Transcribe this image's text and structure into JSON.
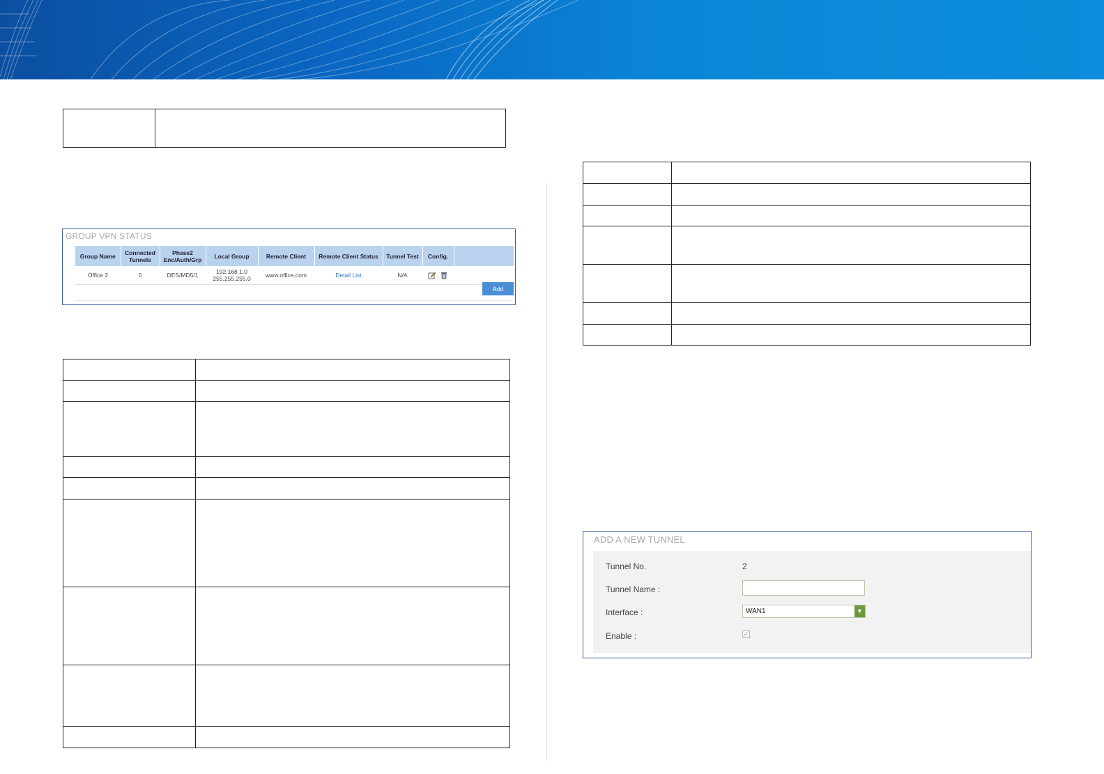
{
  "group_vpn_status": {
    "title": "GROUP VPN STATUS",
    "columns": [
      "Group Name",
      "Connected Tunnels",
      "Phase2 Enc/Auth/Grp",
      "Local Group",
      "Remote Client",
      "Remote Client Status",
      "Tunnel Test",
      "Config."
    ],
    "rows": [
      {
        "group_name": "Office 2",
        "connected_tunnels": "0",
        "phase2": "DES/MD5/1",
        "local_group_ip": "192.168.1.0",
        "local_group_mask": "255.255.255.0",
        "remote_client": "www.office.com",
        "remote_client_status": "Detail List",
        "tunnel_test": "N/A",
        "config_icons": [
          "edit-icon",
          "delete-icon"
        ]
      }
    ],
    "add_label": "Add"
  },
  "add_new_tunnel": {
    "title": "ADD A NEW TUNNEL",
    "tunnel_no_label": "Tunnel No.",
    "tunnel_no_value": "2",
    "tunnel_name_label": "Tunnel Name :",
    "tunnel_name_value": "",
    "interface_label": "Interface :",
    "interface_value": "WAN1",
    "enable_label": "Enable :",
    "enable_checked": true
  },
  "colors": {
    "banner": "#0a66c2",
    "panel_border": "#3d5da0",
    "header_row": "#b9d2ee",
    "link": "#2d74c4",
    "button": "#4a8fd6"
  }
}
